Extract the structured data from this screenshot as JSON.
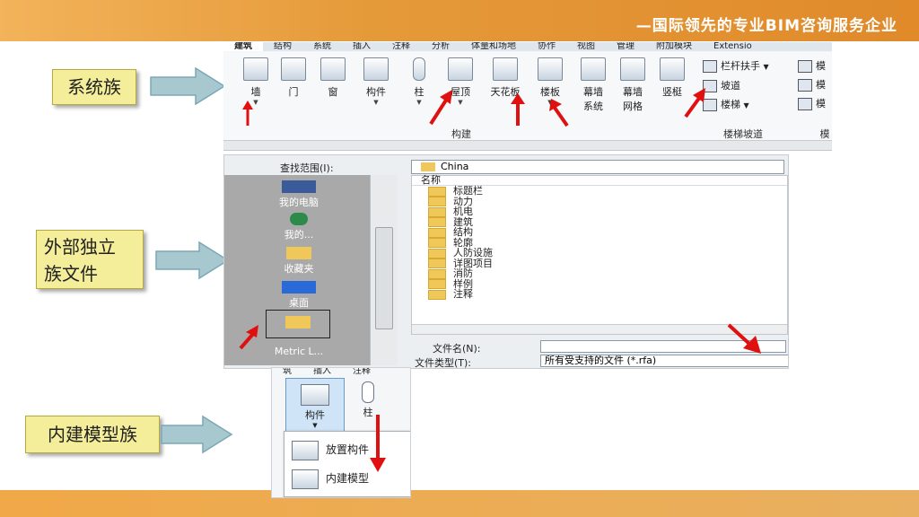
{
  "header": {
    "slogan": "—国际领先的专业BIM咨询服务企业"
  },
  "callouts": {
    "system_family": "系统族",
    "external_family_line1": "外部独立",
    "external_family_line2": "族文件",
    "inplace_family": "内建模型族"
  },
  "ribbon": {
    "tabs": [
      "建筑",
      "结构",
      "系统",
      "插入",
      "注释",
      "分析",
      "体量和场地",
      "协作",
      "视图",
      "管理",
      "附加模块",
      "Extensio"
    ],
    "tools": [
      {
        "label": "墙"
      },
      {
        "label": "门"
      },
      {
        "label": "窗"
      },
      {
        "label": "构件"
      },
      {
        "label": "柱"
      },
      {
        "label": "屋顶"
      },
      {
        "label": "天花板"
      },
      {
        "label": "楼板"
      },
      {
        "label": "幕墙",
        "label2": "系统"
      },
      {
        "label": "幕墙",
        "label2": "网格"
      },
      {
        "label": "竖梃"
      }
    ],
    "group_build": "构建",
    "stairs": [
      "栏杆扶手",
      "坡道",
      "楼梯"
    ],
    "group_stairs": "楼梯坡道",
    "model": [
      "模",
      "模",
      "模"
    ],
    "group_model": "模"
  },
  "dialog": {
    "lookin_label": "查找范围(I):",
    "lookin_value": "China",
    "column_header": "名称",
    "places": [
      "我的电脑",
      "我的...",
      "收藏夹",
      "桌面",
      "Metric L..."
    ],
    "folders": [
      "标题栏",
      "动力",
      "机电",
      "建筑",
      "结构",
      "轮廓",
      "人防设施",
      "详图项目",
      "消防",
      "样例",
      "注释"
    ],
    "filename_label": "文件名(N):",
    "filetype_label": "文件类型(T):",
    "filetype_value": "所有受支持的文件 (*.rfa)"
  },
  "component": {
    "tabs": [
      "筑",
      "插入",
      "注释"
    ],
    "main_label": "构件",
    "pillar_label": "柱",
    "menu": [
      "放置构件",
      "内建模型"
    ]
  },
  "colors": {
    "band": "#e59a3a",
    "callout_bg": "#f4ee9a",
    "arrow": "#a8c8d0",
    "red_arrow": "#e01010"
  }
}
